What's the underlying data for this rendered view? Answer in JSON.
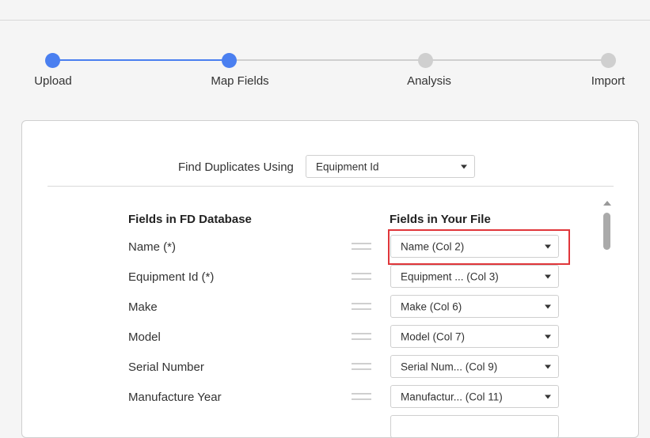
{
  "stepper": {
    "steps": [
      {
        "label": "Upload",
        "state": "completed"
      },
      {
        "label": "Map Fields",
        "state": "current"
      },
      {
        "label": "Analysis",
        "state": "pending"
      },
      {
        "label": "Import",
        "state": "pending"
      }
    ],
    "active_color": "#4a7ff0",
    "inactive_color": "#cfcfcf"
  },
  "duplicates": {
    "label": "Find Duplicates Using",
    "selected": "Equipment Id"
  },
  "mapping": {
    "db_header": "Fields in FD Database",
    "file_header": "Fields in Your File",
    "rows": [
      {
        "field": "Name (*)",
        "mapped": "Name (Col 2)",
        "highlighted": true
      },
      {
        "field": "Equipment Id (*)",
        "mapped": "Equipment ... (Col 3)"
      },
      {
        "field": "Make",
        "mapped": "Make (Col 6)"
      },
      {
        "field": "Model",
        "mapped": "Model (Col 7)"
      },
      {
        "field": "Serial Number",
        "mapped": "Serial Num... (Col 9)"
      },
      {
        "field": "Manufacture Year",
        "mapped": "Manufactur... (Col 11)"
      }
    ]
  },
  "highlight_color": "#e0363a"
}
